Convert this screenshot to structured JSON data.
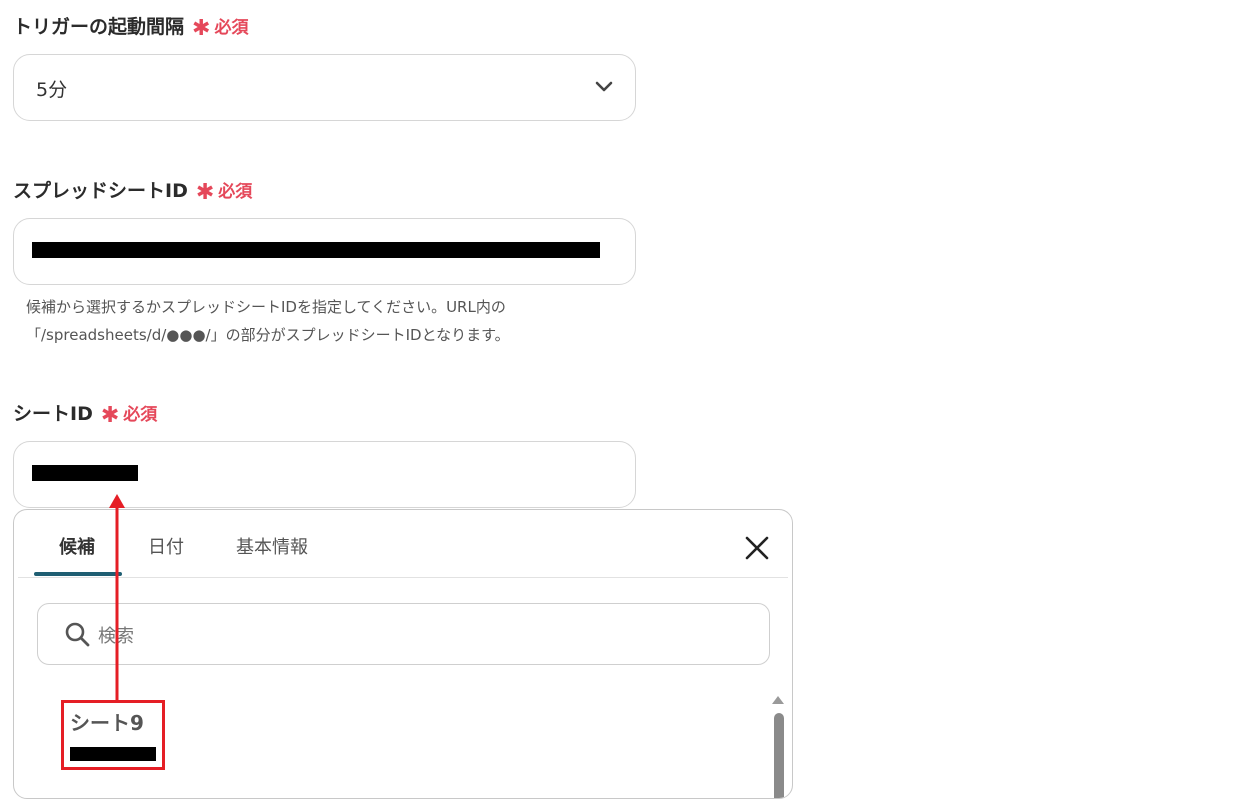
{
  "trigger": {
    "label": "トリガーの起動間隔",
    "required_mark": "✱",
    "required_text": "必須",
    "value": "5分"
  },
  "spreadsheet": {
    "label": "スプレッドシートID",
    "required_mark": "✱",
    "required_text": "必須",
    "help_line1": "候補から選択するかスプレッドシートIDを指定してください。URL内の",
    "help_line2": "「/spreadsheets/d/●●●/」の部分がスプレッドシートIDとなります。"
  },
  "sheet": {
    "label": "シートID",
    "required_mark": "✱",
    "required_text": "必須"
  },
  "popup": {
    "tabs": [
      {
        "label": "候補",
        "active": true
      },
      {
        "label": "日付",
        "active": false
      },
      {
        "label": "基本情報",
        "active": false
      }
    ],
    "search_placeholder": "検索",
    "option": {
      "title": "シート9"
    }
  },
  "colors": {
    "required": "#e5485a",
    "tab_underline": "#1f5e72",
    "annotation": "#e51e25"
  },
  "icons": [
    "chevron-down-icon",
    "close-icon",
    "search-icon"
  ]
}
